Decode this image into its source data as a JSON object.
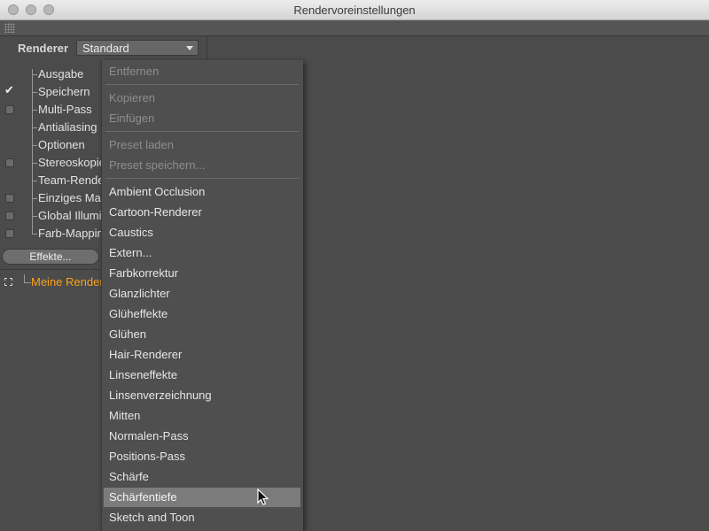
{
  "window": {
    "title": "Rendervoreinstellungen"
  },
  "renderer": {
    "label": "Renderer",
    "value": "Standard"
  },
  "tree": [
    {
      "label": "Ausgabe",
      "checkbox": "none"
    },
    {
      "label": "Speichern",
      "checkbox": "checked"
    },
    {
      "label": "Multi-Pass",
      "checkbox": "unchecked"
    },
    {
      "label": "Antialiasing",
      "checkbox": "none"
    },
    {
      "label": "Optionen",
      "checkbox": "none"
    },
    {
      "label": "Stereoskopie",
      "checkbox": "unchecked"
    },
    {
      "label": "Team-Render",
      "checkbox": "none"
    },
    {
      "label": "Einziges Ma",
      "checkbox": "unchecked"
    },
    {
      "label": "Global Illumi",
      "checkbox": "unchecked"
    },
    {
      "label": "Farb-Mappin",
      "checkbox": "unchecked"
    }
  ],
  "effects_button": "Effekte...",
  "preset": {
    "label": "Meine Render"
  },
  "menu": {
    "group1": [
      {
        "label": "Entfernen",
        "enabled": false
      }
    ],
    "group2": [
      {
        "label": "Kopieren",
        "enabled": false
      },
      {
        "label": "Einfügen",
        "enabled": false
      }
    ],
    "group3": [
      {
        "label": "Preset laden",
        "enabled": false
      },
      {
        "label": "Preset speichern...",
        "enabled": false
      }
    ],
    "effects": [
      "Ambient Occlusion",
      "Cartoon-Renderer",
      "Caustics",
      "Extern...",
      "Farbkorrektur",
      "Glanzlichter",
      "Glüheffekte",
      "Glühen",
      "Hair-Renderer",
      "Linseneffekte",
      "Linsenverzeichnung",
      "Mitten",
      "Normalen-Pass",
      "Positions-Pass",
      "Schärfe",
      "Schärfentiefe",
      "Sketch and Toon"
    ],
    "highlighted": "Schärfentiefe"
  },
  "colors": {
    "accent": "#f7a21b",
    "highlight": "#7b7b7b"
  }
}
